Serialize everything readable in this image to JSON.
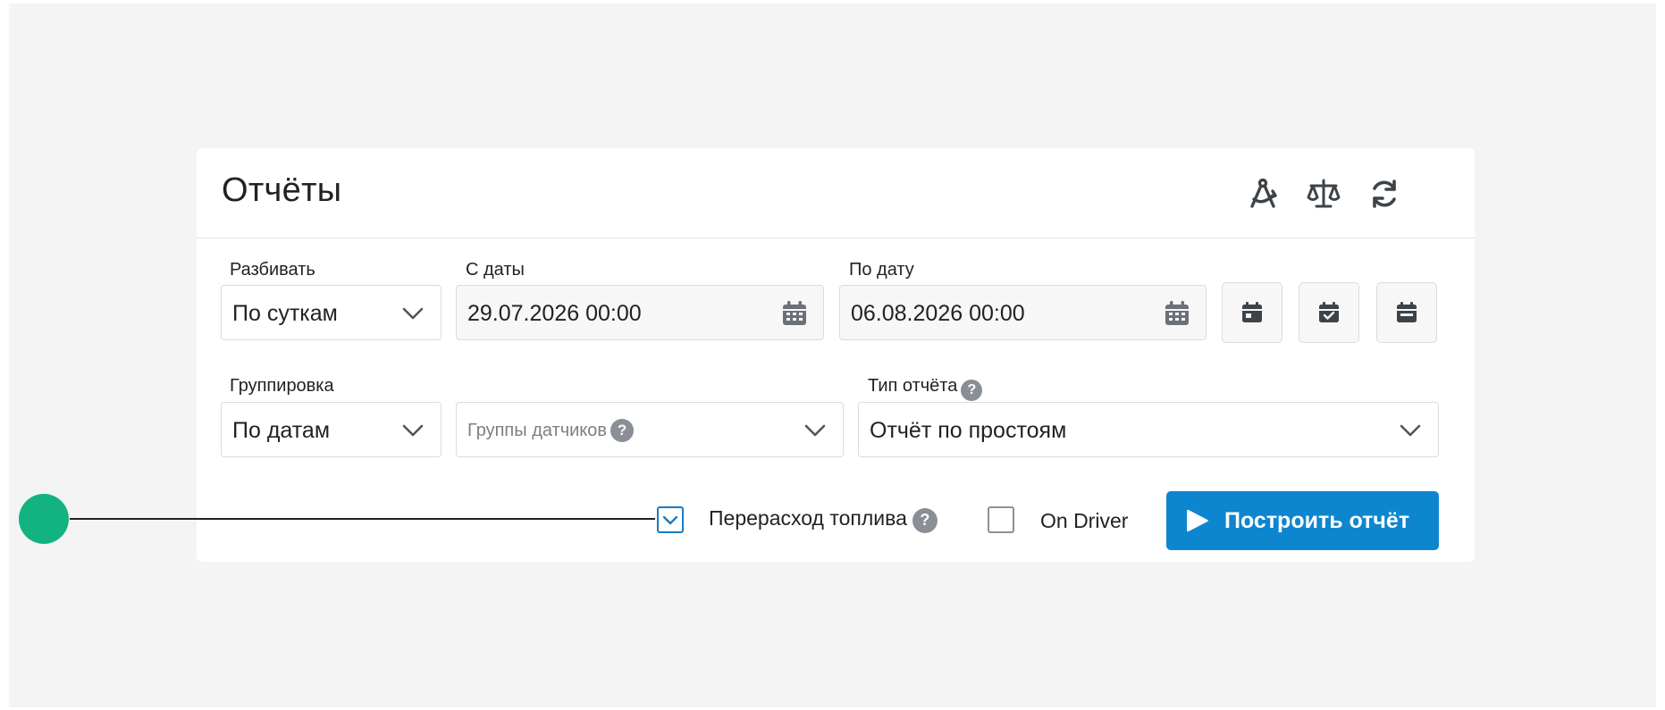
{
  "header": {
    "title": "Отчёты",
    "icons": [
      "compass-icon",
      "scales-icon",
      "refresh-icon"
    ]
  },
  "row1": {
    "split": {
      "label": "Разбивать",
      "value": "По суткам"
    },
    "date_from": {
      "label": "С даты",
      "value": "29.07.2026 00:00"
    },
    "date_to": {
      "label": "По дату",
      "value": "06.08.2026 00:00"
    },
    "quick_buttons": [
      "calendar-today-icon",
      "calendar-check-icon",
      "calendar-range-icon"
    ]
  },
  "row2": {
    "grouping": {
      "label": "Группировка",
      "value": "По датам"
    },
    "sensor_groups": {
      "placeholder": "Группы датчиков",
      "help": "?"
    },
    "report_type": {
      "label": "Тип отчёта",
      "help": "?",
      "value": "Отчёт по простоям"
    }
  },
  "options": {
    "fuel_overuse": {
      "label": "Перерасход топлива",
      "help": "?",
      "checked": true
    },
    "on_driver": {
      "label": "On Driver",
      "checked": false
    }
  },
  "actions": {
    "build_label": "Построить отчёт"
  },
  "colors": {
    "accent": "#0d86cf",
    "checkbox": "#1a7cc2",
    "pointer": "#12b381",
    "background": "#f4f4f4"
  }
}
